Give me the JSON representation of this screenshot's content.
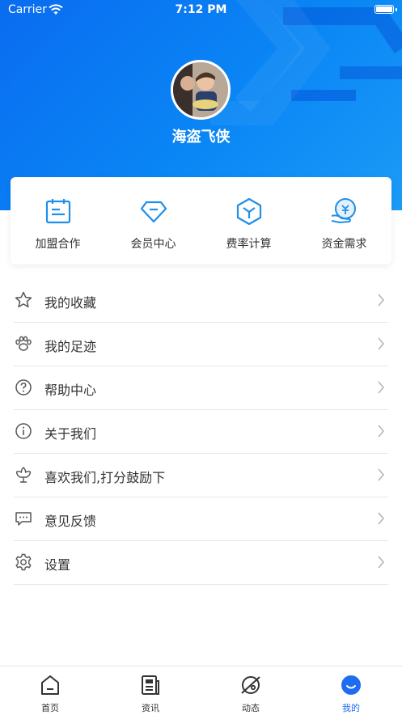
{
  "status_bar": {
    "carrier": "Carrier",
    "time": "7:12 PM"
  },
  "profile": {
    "username": "海盗飞侠"
  },
  "quick_actions": [
    {
      "label": "加盟合作",
      "icon": "notepad-icon"
    },
    {
      "label": "会员中心",
      "icon": "diamond-icon"
    },
    {
      "label": "费率计算",
      "icon": "cube-icon"
    },
    {
      "label": "资金需求",
      "icon": "money-hand-icon"
    }
  ],
  "menu": [
    {
      "label": "我的收藏",
      "icon": "star-icon"
    },
    {
      "label": "我的足迹",
      "icon": "paw-icon"
    },
    {
      "label": "帮助中心",
      "icon": "question-icon"
    },
    {
      "label": "关于我们",
      "icon": "info-icon"
    },
    {
      "label": "喜欢我们,打分鼓励下",
      "icon": "flower-icon"
    },
    {
      "label": "意见反馈",
      "icon": "chat-icon"
    },
    {
      "label": "设置",
      "icon": "gear-icon"
    }
  ],
  "tabbar": [
    {
      "label": "首页",
      "icon": "home-icon"
    },
    {
      "label": "资讯",
      "icon": "newspaper-icon"
    },
    {
      "label": "动态",
      "icon": "planet-icon"
    },
    {
      "label": "我的",
      "icon": "profile-smile-icon",
      "active": true
    }
  ],
  "colors": {
    "primary": "#1e6cf0",
    "header_start": "#0a6cf0",
    "header_end": "#1b9bf7",
    "icon_blue": "#1f8fe8"
  }
}
